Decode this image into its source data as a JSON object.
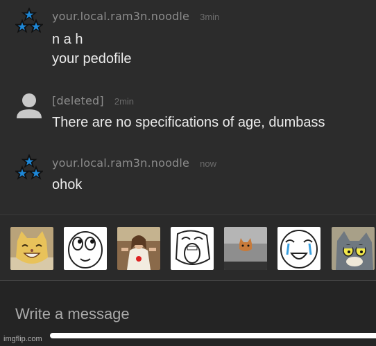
{
  "messages": [
    {
      "username": "your.local.ram3n.noodle",
      "time": "3min",
      "lines": [
        "n a h",
        "your pedofile"
      ],
      "avatar": "blue-stars-avatar-icon"
    },
    {
      "username": "[deleted]",
      "time": "2min",
      "lines": [
        "There are no specifications of age, dumbass"
      ],
      "avatar": "default-person-avatar-icon"
    },
    {
      "username": "your.local.ram3n.noodle",
      "time": "now",
      "lines": [
        "ohok"
      ],
      "avatar": "blue-stars-avatar-icon"
    }
  ],
  "stickers": [
    "smiling-cat-sticker",
    "rage-face-looking-sticker",
    "buddy-christ-sticker",
    "lol-face-sticker",
    "ceiling-cat-sticker",
    "happy-crying-face-sticker",
    "uncanny-tom-cat-sticker"
  ],
  "composer": {
    "placeholder": "Write a message"
  },
  "watermark": "imgflip.com",
  "colors": {
    "background": "#2c2c2c",
    "username": "#8c8c8c",
    "message_text": "#ececec",
    "star_blue": "#1e88d8"
  }
}
